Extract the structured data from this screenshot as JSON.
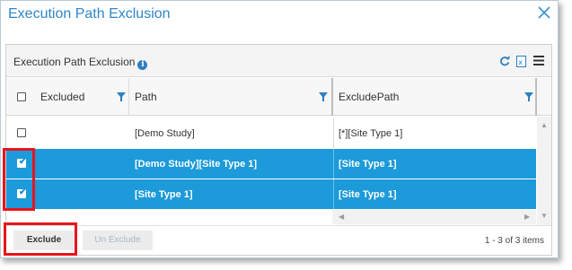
{
  "dialog": {
    "title": "Execution Path Exclusion"
  },
  "panel": {
    "title": "Execution Path Exclusion"
  },
  "columns": {
    "excluded": "Excluded",
    "path": "Path",
    "exclude_path": "ExcludePath"
  },
  "rows": [
    {
      "checked": false,
      "selected": false,
      "path": "[Demo Study]",
      "exclude_path": "[*][Site Type 1]"
    },
    {
      "checked": true,
      "selected": true,
      "path": "[Demo Study][Site Type 1]",
      "exclude_path": "[Site Type 1]"
    },
    {
      "checked": true,
      "selected": true,
      "path": "[Site Type 1]",
      "exclude_path": "[Site Type 1]"
    }
  ],
  "footer": {
    "exclude_label": "Exclude",
    "unexclude_label": "Un Exclude",
    "pager_text": "1 - 3 of 3 items"
  },
  "colors": {
    "accent": "#2e86c9",
    "selected_row": "#1c9ad9",
    "highlight": "#e8141c"
  },
  "icons": [
    "close-icon",
    "info-icon",
    "refresh-icon",
    "excel-export-icon",
    "menu-icon",
    "filter-icon",
    "checkbox-icon",
    "scroll-arrow-icon"
  ]
}
